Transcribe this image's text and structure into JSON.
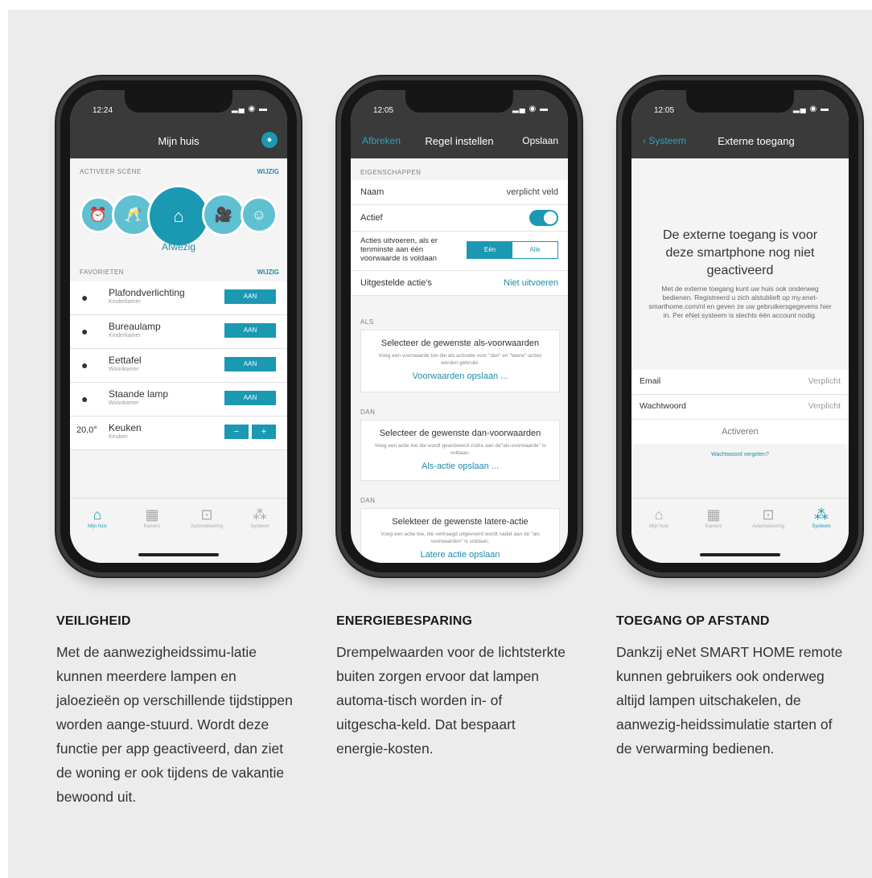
{
  "phones": [
    {
      "time": "12:24",
      "nav_title": "Mijn huis",
      "section_scene": "ACTIVEER SCÈNE",
      "wijzig": "WIJZIG",
      "active_scene": "Afwezig",
      "section_favorites": "FAVORIETEN",
      "favorites": [
        {
          "name": "Plafondverlichting",
          "room": "Kinderkamer",
          "button": "AAN"
        },
        {
          "name": "Bureaulamp",
          "room": "Kinderkamer",
          "button": "AAN"
        },
        {
          "name": "Eettafel",
          "room": "Woonkamer",
          "button": "AAN"
        },
        {
          "name": "Staande lamp",
          "room": "Woonkamer",
          "button": "AAN"
        }
      ],
      "thermo": {
        "temp": "20,0°",
        "name": "Keuken",
        "room": "Keuken",
        "minus": "−",
        "plus": "+"
      },
      "tabs": [
        "Mijn huis",
        "Kamers",
        "Automatisering",
        "Systeem"
      ]
    },
    {
      "time": "12:05",
      "nav_left": "Afbreken",
      "nav_title": "Regel instellen",
      "nav_right": "Opslaan",
      "section_props": "EIGENSCHAPPEN",
      "naam_label": "Naam",
      "naam_value": "verplicht veld",
      "actief_label": "Actief",
      "acties_label": "Acties uitvoeren, als er tenminste aan één voorwaarde is voldaan",
      "seg_a": "Eén",
      "seg_b": "Alle",
      "uitgesteld_label": "Uitgestelde actie's",
      "uitgesteld_value": "Niet uitvoeren",
      "section_als": "ALS",
      "card_als": {
        "title": "Selecteer de gewenste als-voorwaarden",
        "desc": "Voeg een voorwaarde toe die als activatie voor \"dan\" en \"latere\"-acties worden gebruikt.",
        "link": "Voorwaarden opslaan ..."
      },
      "section_dan": "DAN",
      "card_dan": {
        "title": "Selecteer de gewenste dan-voorwaarden",
        "desc": "Voeg een actie toe die wordt geactiveerd zodra aan de\"als-voorwaarde\" is voldaan.",
        "link": "Als-actie opslaan ..."
      },
      "section_dan2": "DAN",
      "card_later": {
        "title": "Selekteer de gewenste latere-actie",
        "desc": "Voeg een actie toe, die vertraagd uitgevoerd wordt nadat aan de \"als voorwaarden\" is voldaan.",
        "link": "Latere actie opslaan"
      }
    },
    {
      "time": "12:05",
      "nav_left": "Systeem",
      "nav_title": "Externe toegang",
      "heading": "De externe toegang is voor deze smartphone nog niet geactiveerd",
      "body": "Met de externe toegang kunt uw huis ook onderweg bedienen. Registreerd u zich alstublieft op my.enet-smarthome.com/nl en geven ze uw gebruikersgegevens hier in. Per eNet systeem is slechts één account nodig.",
      "email_label": "Email",
      "email_value": "Verplicht",
      "pw_label": "Wachtwoord",
      "pw_value": "Verplicht",
      "activate": "Activeren",
      "forgot": "Wachtwoord vergeten?",
      "tabs": [
        "Mijn huis",
        "Kamers",
        "Automatisering",
        "Systeem"
      ]
    }
  ],
  "captions": [
    {
      "title": "VEILIGHEID",
      "text": "Met de aanwezigheidssimu-latie kunnen meerdere lampen en jaloezieën op verschillende tijdstippen worden aange-stuurd. Wordt deze functie per app geactiveerd, dan ziet de woning er ook tijdens de vakantie bewoond uit."
    },
    {
      "title": "ENERGIEBESPARING",
      "text": "Drempelwaarden voor de lichtsterkte buiten zorgen ervoor dat lampen automa-tisch worden in- of uitgescha-keld. Dat bespaart energie-kosten."
    },
    {
      "title": "TOEGANG OP AFSTAND",
      "text": "Dankzij eNet SMART HOME remote kunnen gebruikers ook onderweg altijd lampen uitschakelen, de aanwezig-heidssimulatie starten of de verwarming bedienen."
    }
  ],
  "colors": {
    "accent": "#1b98b2",
    "navbar": "#3a3a3a",
    "background": "#ececec"
  }
}
